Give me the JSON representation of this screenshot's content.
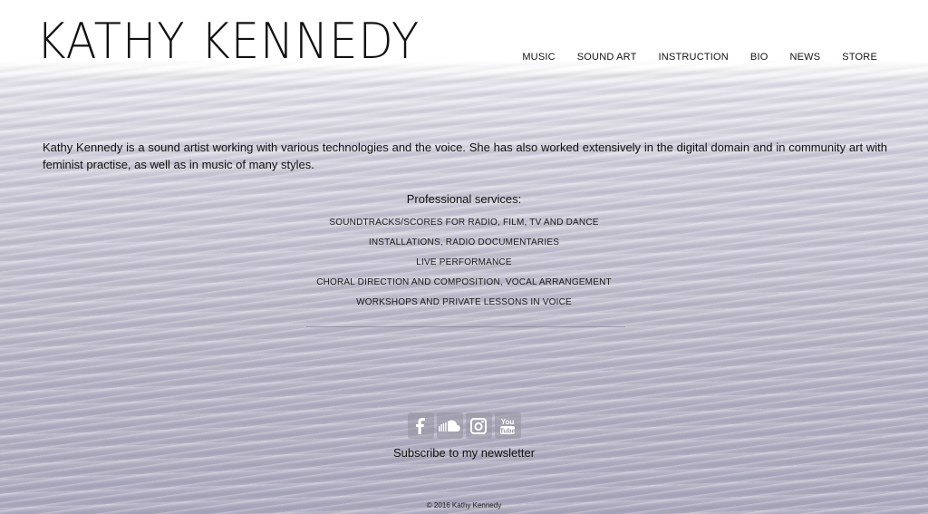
{
  "site": {
    "title": "KATHY KENNEDY"
  },
  "nav": {
    "items": [
      {
        "label": "MUSIC"
      },
      {
        "label": "SOUND ART"
      },
      {
        "label": "INSTRUCTION"
      },
      {
        "label": "BIO"
      },
      {
        "label": "NEWS"
      },
      {
        "label": "STORE"
      }
    ]
  },
  "intro": {
    "text": "Kathy Kennedy is a sound artist working with various technologies and the voice. She has also worked extensively in the digital domain and in community art with feminist practise, as well as in music of many styles."
  },
  "services": {
    "title": "Professional services:",
    "items": [
      {
        "label": "SOUNDTRACKS/SCORES FOR RADIO, FILM, TV AND DANCE"
      },
      {
        "label": "INSTALLATIONS, RADIO DOCUMENTARIES"
      },
      {
        "label": "LIVE PERFORMANCE"
      },
      {
        "label": "CHORAL DIRECTION AND COMPOSITION, VOCAL ARRANGEMENT"
      },
      {
        "label": "WORKSHOPS AND PRIVATE LESSONS IN VOICE"
      }
    ]
  },
  "social": {
    "icons": [
      "facebook-icon",
      "soundcloud-icon",
      "instagram-icon",
      "youtube-icon"
    ],
    "youtube_text": "You Tube"
  },
  "newsletter": {
    "label": "Subscribe to my newsletter"
  },
  "footer": {
    "copyright": "© 2016 Kathy Kennedy"
  },
  "colors": {
    "text": "#111111",
    "social_button_bg": "#9a98a6",
    "water_top": "#e9e8ef",
    "water_bottom": "#aeacbf"
  }
}
